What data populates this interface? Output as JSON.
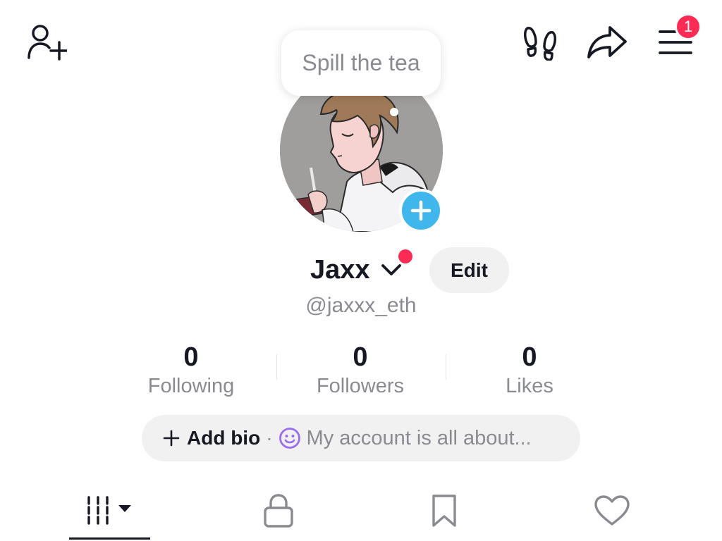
{
  "header": {
    "notification_count": "1",
    "icons": [
      "add-friend-icon",
      "footprints-icon",
      "share-icon",
      "menu-icon"
    ]
  },
  "tooltip": {
    "text": "Spill the tea"
  },
  "profile": {
    "name": "Jaxx",
    "handle": "@jaxxx_eth",
    "edit_label": "Edit"
  },
  "stats": [
    {
      "value": "0",
      "label": "Following"
    },
    {
      "value": "0",
      "label": "Followers"
    },
    {
      "value": "0",
      "label": "Likes"
    }
  ],
  "bio": {
    "add_label": "Add bio",
    "separator": "·",
    "prompt": "My account is all about..."
  },
  "tabs": [
    "videos-grid-icon",
    "private-lock-icon",
    "favorites-bookmark-icon",
    "liked-heart-icon"
  ],
  "colors": {
    "accent_red": "#FE2C55",
    "avatar_plus": "#3fb6ec",
    "secondary_text": "#8a8b91",
    "pill_bg": "#f1f1f2",
    "emoji_purple": "#9a6cf0"
  }
}
